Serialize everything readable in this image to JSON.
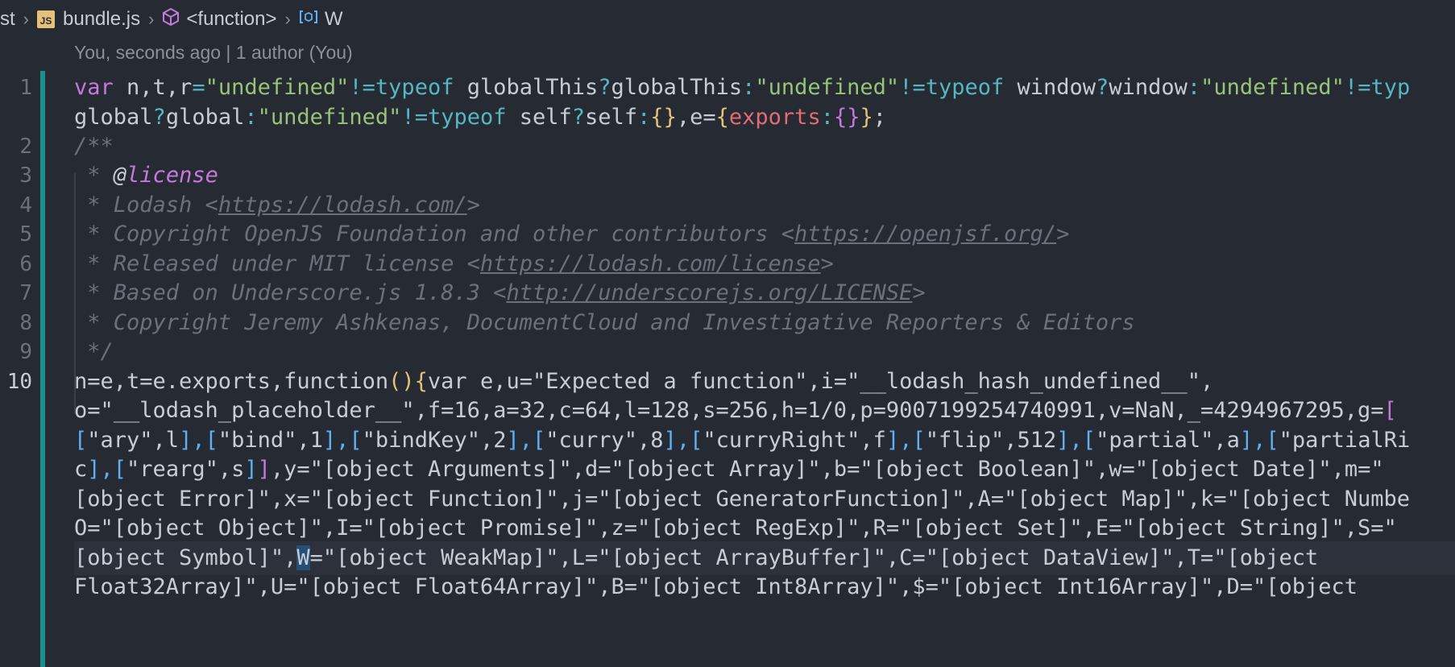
{
  "breadcrumb": {
    "segments": [
      "st",
      "bundle.js",
      "<function>",
      "W"
    ],
    "file_icon_text": "JS"
  },
  "blame": "You, seconds ago | 1 author (You)",
  "line_numbers": [
    "1",
    "2",
    "3",
    "4",
    "5",
    "6",
    "7",
    "8",
    "9",
    "10"
  ],
  "code": {
    "l1a_var": "var",
    "l1a_rest1": " n,t,r",
    "l1a_eq": "=",
    "l1a_s1": "\"undefined\"",
    "l1a_ne1": "!=",
    "l1a_typeof1": "typeof",
    "l1a_gt1": " globalThis",
    "l1a_q1": "?",
    "l1a_gt2": "globalThis",
    "l1a_c1": ":",
    "l1a_s2": "\"undefined\"",
    "l1a_ne2": "!=",
    "l1a_typeof2": "typeof",
    "l1a_w1": " window",
    "l1a_q2": "?",
    "l1a_w2": "window",
    "l1a_c2": ":",
    "l1a_s3": "\"undefined\"",
    "l1a_ne3": "!=",
    "l1a_typeof3": "typ",
    "l1b_g1": "global",
    "l1b_q": "?",
    "l1b_g2": "global",
    "l1b_c": ":",
    "l1b_s": "\"undefined\"",
    "l1b_ne": "!=",
    "l1b_typeof": "typeof",
    "l1b_self1": " self",
    "l1b_q2": "?",
    "l1b_self2": "self",
    "l1b_c2": ":",
    "l1b_br": "{}",
    "l1b_e": ",e=",
    "l1b_ob": "{",
    "l1b_exp": "exports",
    "l1b_c3": ":",
    "l1b_inner": "{}",
    "l1b_cb": "}",
    "l1b_end": ";",
    "c2": "/**",
    "c3_star": " * ",
    "c3_at": "@",
    "c3_tag": "license",
    "c4_a": " * Lodash <",
    "c4_url": "https://lodash.com/",
    "c4_b": ">",
    "c5_a": " * Copyright OpenJS Foundation and other contributors <",
    "c5_url": "https://openjsf.org/",
    "c5_b": ">",
    "c6_a": " * Released under MIT license <",
    "c6_url": "https://lodash.com/license",
    "c6_b": ">",
    "c7_a": " * Based on Underscore.js 1.8.3 <",
    "c7_url": "http://underscorejs.org/LICENSE",
    "c7_b": ">",
    "c8": " * Copyright Jeremy Ashkenas, DocumentCloud and Investigative Reporters & Editors",
    "c9": " */",
    "l10a_1": "n=e,t=e.exports,function",
    "l10a_p": "()",
    "l10a_b": "{",
    "l10a_2": "var e,u=\"Expected a function\",i=\"__lodash_hash_undefined__\",",
    "l10b": "o=\"__lodash_placeholder__\",f=16,a=32,c=64,l=128,s=256,h=1/0,p=9007199254740991,v=NaN,_=4294967295,g=",
    "l10b_br": "[",
    "l10c_1": "[",
    "l10c_2": "\"ary\",l",
    "l10c_3": "],",
    "l10c_4": "[",
    "l10c_5": "\"bind\",1",
    "l10c_6": "],",
    "l10c_7": "[",
    "l10c_8": "\"bindKey\",2",
    "l10c_9": "],",
    "l10c_10": "[",
    "l10c_11": "\"curry\",8",
    "l10c_12": "],",
    "l10c_13": "[",
    "l10c_14": "\"curryRight\",f",
    "l10c_15": "],",
    "l10c_16": "[",
    "l10c_17": "\"flip\",512",
    "l10c_18": "],",
    "l10c_19": "[",
    "l10c_20": "\"partial\",a",
    "l10c_21": "],",
    "l10c_22": "[",
    "l10c_23": "\"partialRi",
    "l10d_1": "c",
    "l10d_2": "],",
    "l10d_3": "[",
    "l10d_4": "\"rearg\",s",
    "l10d_5": "]",
    "l10d_6": "]",
    "l10d_7": ",y=\"[object Arguments]\",d=\"[object Array]\",b=\"[object Boolean]\",w=\"[object Date]\",m=\"",
    "l10e": "[object Error]\",x=\"[object Function]\",j=\"[object GeneratorFunction]\",A=\"[object Map]\",k=\"[object Numbe",
    "l10f": "O=\"[object Object]\",I=\"[object Promise]\",z=\"[object RegExp]\",R=\"[object Set]\",E=\"[object String]\",S=\"",
    "l10g_1": "[object Symbol]\",",
    "l10g_w": "W",
    "l10g_2": "=\"[object WeakMap]\",L=\"[object ArrayBuffer]\",C=\"[object DataView]\",T=\"[object",
    "l10h": "Float32Array]\",U=\"[object Float64Array]\",B=\"[object Int8Array]\",$=\"[object Int16Array]\",D=\"[object"
  }
}
